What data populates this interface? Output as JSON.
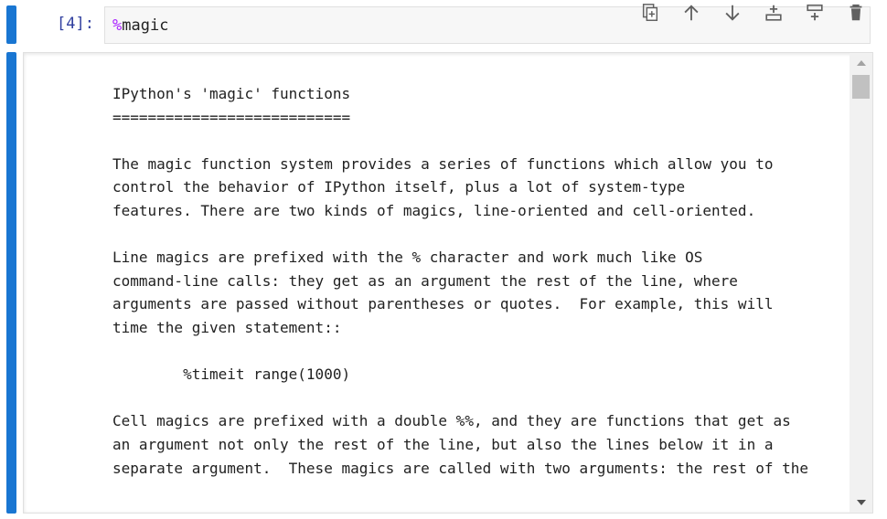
{
  "input_cell": {
    "prompt": "[4]:",
    "code_prefix": "%",
    "code_rest": "magic"
  },
  "toolbar": {
    "buttons": [
      {
        "icon": "duplicate-icon"
      },
      {
        "icon": "move-up-icon"
      },
      {
        "icon": "move-down-icon"
      },
      {
        "icon": "insert-above-icon"
      },
      {
        "icon": "insert-below-icon"
      },
      {
        "icon": "delete-icon"
      }
    ]
  },
  "output_cell": {
    "text": "IPython's 'magic' functions\n===========================\n\nThe magic function system provides a series of functions which allow you to\ncontrol the behavior of IPython itself, plus a lot of system-type\nfeatures. There are two kinds of magics, line-oriented and cell-oriented.\n\nLine magics are prefixed with the % character and work much like OS\ncommand-line calls: they get as an argument the rest of the line, where\narguments are passed without parentheses or quotes.  For example, this will\ntime the given statement::\n\n        %timeit range(1000)\n\nCell magics are prefixed with a double %%, and they are functions that get as\nan argument not only the rest of the line, but also the lines below it in a\nseparate argument.  These magics are called with two arguments: the rest of the"
  },
  "colors": {
    "cell_bar": "#1976d2",
    "prompt": "#303f9f",
    "magic_percent": "#aa22ff"
  }
}
